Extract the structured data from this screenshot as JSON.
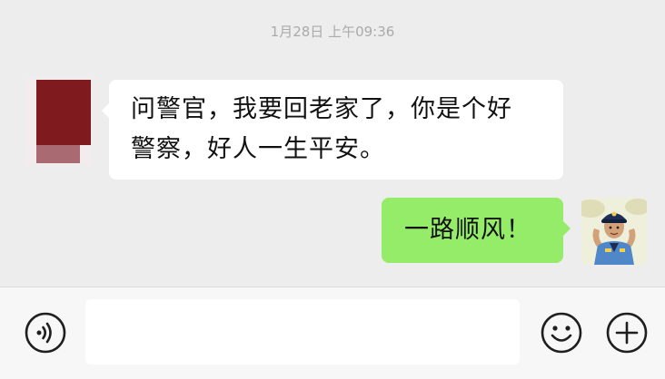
{
  "chat": {
    "timestamp": "1月28日 上午09:36",
    "messages": [
      {
        "direction": "incoming",
        "text": "问警官，我要回老家了，你是个好\n警察，好人一生平安。",
        "avatar": "red-square-avatar"
      },
      {
        "direction": "outgoing",
        "text": "一路顺风！",
        "avatar": "cartoon-police-officer-avatar"
      }
    ]
  },
  "input_bar": {
    "voice_icon": "voice-input-icon",
    "input_value": "",
    "emoji_icon": "emoji-icon",
    "plus_icon": "plus-icon"
  },
  "colors": {
    "chat_background": "#ededed",
    "incoming_bubble": "#ffffff",
    "outgoing_bubble": "#95ec69",
    "input_bar_background": "#f7f7f7"
  }
}
